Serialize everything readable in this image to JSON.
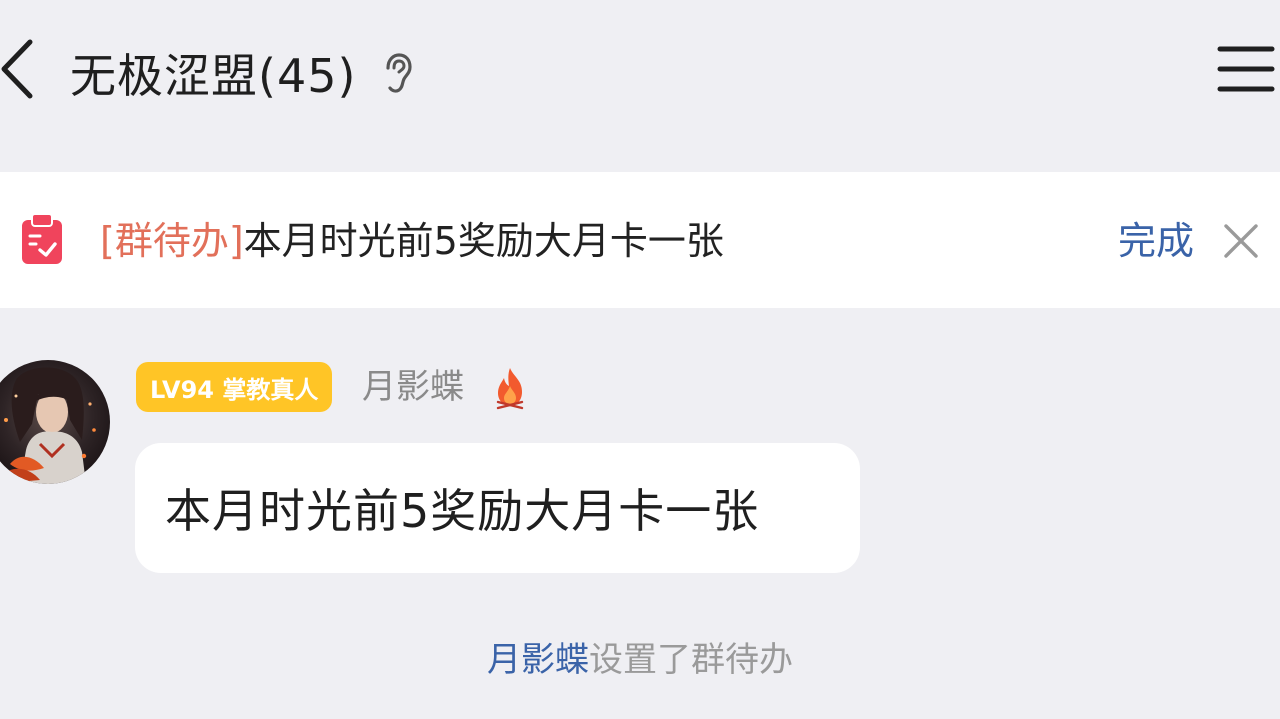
{
  "header": {
    "title": "无极涩盟(45)",
    "icons": {
      "back": "chevron-left-icon",
      "ear": "ear-icon",
      "menu": "hamburger-menu-icon"
    }
  },
  "todo": {
    "icon": "clipboard-check-icon",
    "tag": "[群待办]",
    "text": "本月时光前5奖励大月卡一张",
    "done_label": "完成",
    "close_icon": "close-icon",
    "colors": {
      "tag": "#e2705a",
      "done": "#3a63a8",
      "icon": "#f0445c"
    }
  },
  "message": {
    "level_badge": "LV94 掌教真人",
    "sender": "月影蝶",
    "sender_icon": "fire-icon",
    "text": "本月时光前5奖励大月卡一张",
    "colors": {
      "badge_bg": "#ffc526"
    }
  },
  "system_notice": {
    "user": "月影蝶",
    "action": "设置了群待办"
  }
}
